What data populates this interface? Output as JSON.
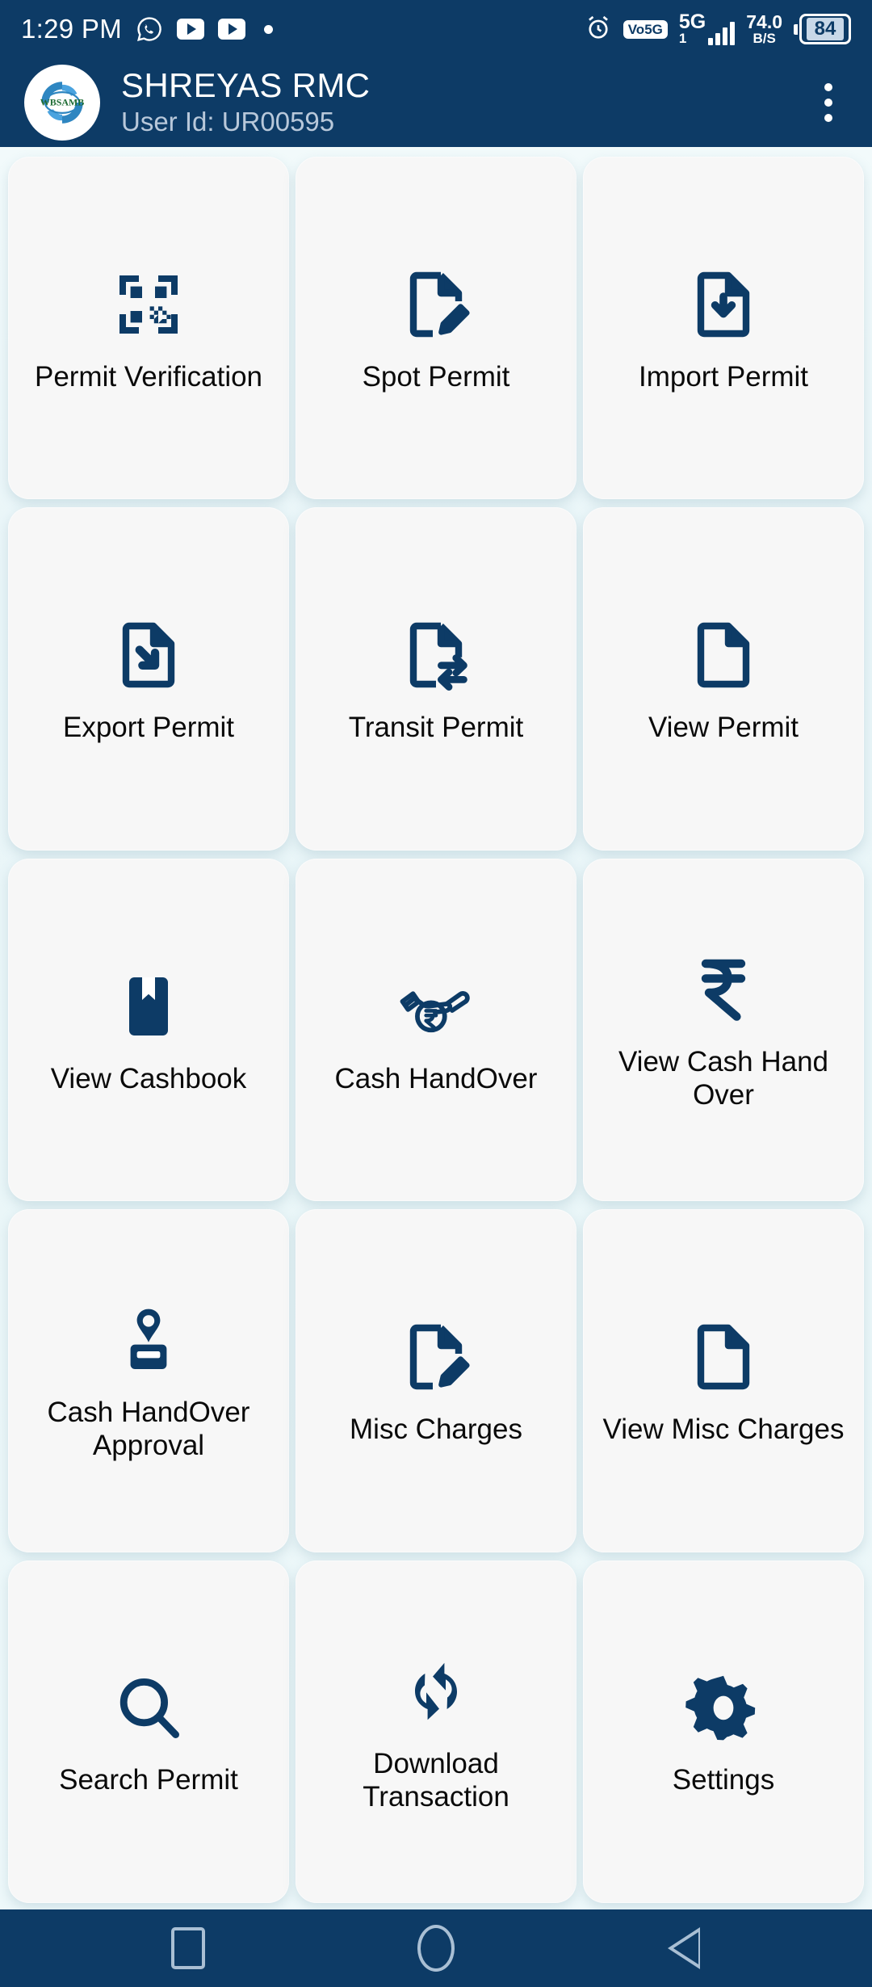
{
  "status_bar": {
    "time": "1:29 PM",
    "icons_left": [
      "whatsapp-icon",
      "youtube-icon",
      "youtube-icon",
      "dot-indicator"
    ],
    "alarm_icon": "alarm-icon",
    "volte_label": "Vo5G",
    "network_type": "5G",
    "network_arrow": "1",
    "net_speed_value": "74.0",
    "net_speed_unit": "B/S",
    "battery_percent": "84"
  },
  "app_bar": {
    "logo_text": "WBSAMB",
    "title": "SHREYAS RMC",
    "subtitle": "User Id: UR00595",
    "menu_icon": "kebab-menu-icon"
  },
  "colors": {
    "header_navy": "#0D3B66",
    "icon_navy": "#0D3B66",
    "tile_bg": "#F7F7F7",
    "page_bg": "#E9F5F8",
    "subtitle": "#B8C8DA",
    "nav_icon": "#A9BFD4"
  },
  "grid": {
    "tiles": [
      {
        "label": "Permit Verification",
        "icon": "qr-scan-icon"
      },
      {
        "label": "Spot Permit",
        "icon": "document-edit-icon"
      },
      {
        "label": "Import Permit",
        "icon": "document-import-icon"
      },
      {
        "label": "Export Permit",
        "icon": "document-export-icon"
      },
      {
        "label": "Transit Permit",
        "icon": "document-transfer-icon"
      },
      {
        "label": "View Permit",
        "icon": "document-icon"
      },
      {
        "label": "View Cashbook",
        "icon": "bookmark-book-icon"
      },
      {
        "label": "Cash HandOver",
        "icon": "hand-rupee-coin-icon"
      },
      {
        "label": "View Cash Hand Over",
        "icon": "rupee-icon"
      },
      {
        "label": "Cash HandOver Approval",
        "icon": "stamp-icon"
      },
      {
        "label": "Misc Charges",
        "icon": "document-edit-icon"
      },
      {
        "label": "View Misc Charges",
        "icon": "document-icon"
      },
      {
        "label": "Search Permit",
        "icon": "magnifier-icon"
      },
      {
        "label": "Download Transaction",
        "icon": "sync-arrows-icon"
      },
      {
        "label": "Settings",
        "icon": "gear-icon"
      }
    ]
  },
  "nav_bar": {
    "recents_label": "recents-square-icon",
    "home_label": "home-circle-icon",
    "back_label": "back-triangle-icon"
  }
}
